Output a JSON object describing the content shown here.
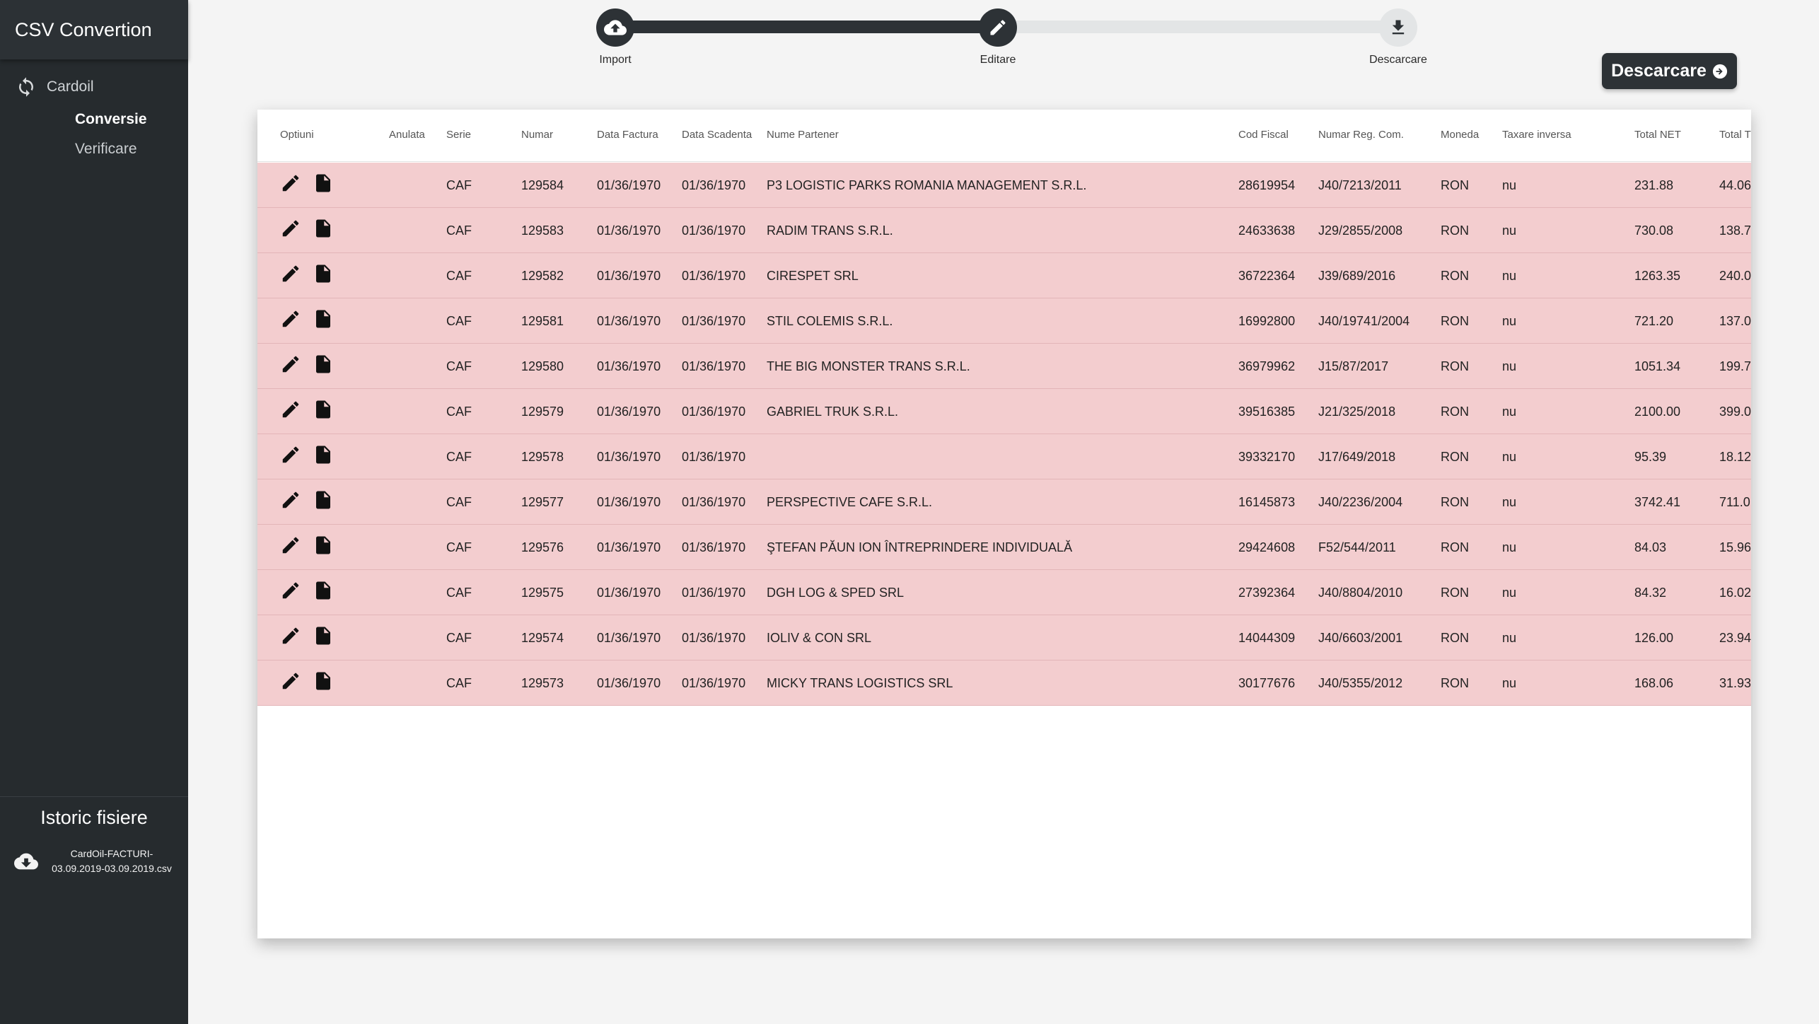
{
  "app": {
    "title": "CSV Convertion"
  },
  "sidebar": {
    "group_label": "Cardoil",
    "group_icon": "sync-icon",
    "items": [
      {
        "label": "Conversie",
        "active": true
      },
      {
        "label": "Verificare",
        "active": false
      }
    ]
  },
  "history": {
    "title": "Istoric fisiere",
    "file_icon": "cloud-download-icon",
    "file_line1": "CardOil-FACTURI-",
    "file_line2": "03.09.2019-03.09.2019.csv"
  },
  "stepper": {
    "steps": [
      {
        "label": "Import",
        "icon": "cloud-upload-icon",
        "state": "done"
      },
      {
        "label": "Editare",
        "icon": "pencil-icon",
        "state": "done"
      },
      {
        "label": "Descarcare",
        "icon": "download-icon",
        "state": "todo"
      }
    ]
  },
  "download_button": {
    "label": "Descarcare",
    "icon": "arrow-circle-right-icon"
  },
  "table": {
    "columns": [
      "Optiuni",
      "Anulata",
      "Serie",
      "Numar",
      "Data Factura",
      "Data Scadenta",
      "Nume Partener",
      "Cod Fiscal",
      "Numar Reg. Com.",
      "Moneda",
      "Taxare inversa",
      "Total NET",
      "Total T"
    ],
    "row_color": "#f3cdcf",
    "rows": [
      {
        "anulata": "",
        "serie": "CAF",
        "numar": "129584",
        "data_factura": "01/36/1970",
        "data_scadenta": "01/36/1970",
        "partener": "P3 LOGISTIC PARKS ROMANIA MANAGEMENT S.R.L.",
        "cod_fiscal": "28619954",
        "reg_com": "J40/7213/2011",
        "moneda": "RON",
        "taxare": "nu",
        "total_net": "231.88",
        "total_tva": "44.06"
      },
      {
        "anulata": "",
        "serie": "CAF",
        "numar": "129583",
        "data_factura": "01/36/1970",
        "data_scadenta": "01/36/1970",
        "partener": "RADIM TRANS S.R.L.",
        "cod_fiscal": "24633638",
        "reg_com": "J29/2855/2008",
        "moneda": "RON",
        "taxare": "nu",
        "total_net": "730.08",
        "total_tva": "138.7"
      },
      {
        "anulata": "",
        "serie": "CAF",
        "numar": "129582",
        "data_factura": "01/36/1970",
        "data_scadenta": "01/36/1970",
        "partener": "CIRESPET SRL",
        "cod_fiscal": "36722364",
        "reg_com": "J39/689/2016",
        "moneda": "RON",
        "taxare": "nu",
        "total_net": "1263.35",
        "total_tva": "240.0"
      },
      {
        "anulata": "",
        "serie": "CAF",
        "numar": "129581",
        "data_factura": "01/36/1970",
        "data_scadenta": "01/36/1970",
        "partener": "STIL COLEMIS S.R.L.",
        "cod_fiscal": "16992800",
        "reg_com": "J40/19741/2004",
        "moneda": "RON",
        "taxare": "nu",
        "total_net": "721.20",
        "total_tva": "137.0"
      },
      {
        "anulata": "",
        "serie": "CAF",
        "numar": "129580",
        "data_factura": "01/36/1970",
        "data_scadenta": "01/36/1970",
        "partener": "THE BIG MONSTER TRANS S.R.L.",
        "cod_fiscal": "36979962",
        "reg_com": "J15/87/2017",
        "moneda": "RON",
        "taxare": "nu",
        "total_net": "1051.34",
        "total_tva": "199.7"
      },
      {
        "anulata": "",
        "serie": "CAF",
        "numar": "129579",
        "data_factura": "01/36/1970",
        "data_scadenta": "01/36/1970",
        "partener": "GABRIEL TRUK S.R.L.",
        "cod_fiscal": "39516385",
        "reg_com": "J21/325/2018",
        "moneda": "RON",
        "taxare": "nu",
        "total_net": "2100.00",
        "total_tva": "399.0"
      },
      {
        "anulata": "",
        "serie": "CAF",
        "numar": "129578",
        "data_factura": "01/36/1970",
        "data_scadenta": "01/36/1970",
        "partener": "",
        "cod_fiscal": "39332170",
        "reg_com": "J17/649/2018",
        "moneda": "RON",
        "taxare": "nu",
        "total_net": "95.39",
        "total_tva": "18.12"
      },
      {
        "anulata": "",
        "serie": "CAF",
        "numar": "129577",
        "data_factura": "01/36/1970",
        "data_scadenta": "01/36/1970",
        "partener": "PERSPECTIVE CAFE S.R.L.",
        "cod_fiscal": "16145873",
        "reg_com": "J40/2236/2004",
        "moneda": "RON",
        "taxare": "nu",
        "total_net": "3742.41",
        "total_tva": "711.0"
      },
      {
        "anulata": "",
        "serie": "CAF",
        "numar": "129576",
        "data_factura": "01/36/1970",
        "data_scadenta": "01/36/1970",
        "partener": "ŞTEFAN PĂUN ION ÎNTREPRINDERE INDIVIDUALĂ",
        "cod_fiscal": "29424608",
        "reg_com": "F52/544/2011",
        "moneda": "RON",
        "taxare": "nu",
        "total_net": "84.03",
        "total_tva": "15.96"
      },
      {
        "anulata": "",
        "serie": "CAF",
        "numar": "129575",
        "data_factura": "01/36/1970",
        "data_scadenta": "01/36/1970",
        "partener": "DGH LOG & SPED SRL",
        "cod_fiscal": "27392364",
        "reg_com": "J40/8804/2010",
        "moneda": "RON",
        "taxare": "nu",
        "total_net": "84.32",
        "total_tva": "16.02"
      },
      {
        "anulata": "",
        "serie": "CAF",
        "numar": "129574",
        "data_factura": "01/36/1970",
        "data_scadenta": "01/36/1970",
        "partener": "IOLIV & CON SRL",
        "cod_fiscal": "14044309",
        "reg_com": "J40/6603/2001",
        "moneda": "RON",
        "taxare": "nu",
        "total_net": "126.00",
        "total_tva": "23.94"
      },
      {
        "anulata": "",
        "serie": "CAF",
        "numar": "129573",
        "data_factura": "01/36/1970",
        "data_scadenta": "01/36/1970",
        "partener": "MICKY TRANS LOGISTICS SRL",
        "cod_fiscal": "30177676",
        "reg_com": "J40/5355/2012",
        "moneda": "RON",
        "taxare": "nu",
        "total_net": "168.06",
        "total_tva": "31.93"
      }
    ]
  }
}
